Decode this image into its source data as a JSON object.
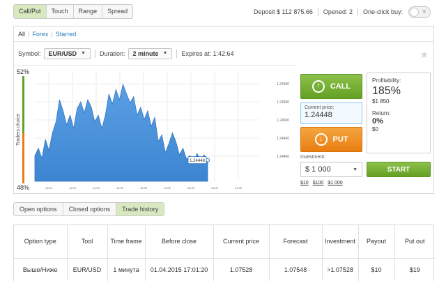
{
  "option_types": [
    "Call/Put",
    "Touch",
    "Range",
    "Spread"
  ],
  "header": {
    "deposit": "Deposit $ 112 875.66",
    "opened": "Opened: 2",
    "one_click": "One-click buy:"
  },
  "filters": {
    "all": "All",
    "forex": "Forex",
    "starred": "Starred"
  },
  "controls": {
    "symbol_label": "Symbol:",
    "symbol_value": "EUR/USD",
    "duration_label": "Duration:",
    "duration_value": "2 minute",
    "expires": "Expires at: 1:42:64"
  },
  "trade": {
    "call_label": "CALL",
    "put_label": "PUT",
    "current_price_label": "Current price:",
    "current_price": "1.24448",
    "investment_label": "Investment:",
    "investment_value": "$ 1 000",
    "presets": [
      "$10",
      "$100",
      "$1 000"
    ],
    "profitability_label": "Profitability:",
    "profitability_pct": "185%",
    "profitability_amount": "$1 850",
    "return_label": "Return:",
    "return_pct": "0%",
    "return_amount": "$0",
    "start_label": "START"
  },
  "chart_data": {
    "type": "area",
    "ylabel": "Traders choice",
    "sentiment_top": "52%",
    "sentiment_bottom": "48%",
    "y_ticks": [
      "1.24600",
      "1.24550",
      "1.24500",
      "1.24450",
      "1.24400"
    ],
    "x_ticks": [
      "10:00",
      "11:00",
      "11:20",
      "12:00",
      "12:30",
      "13:00",
      "13:30",
      "14:00",
      "14:30"
    ],
    "current_label": "1.24448",
    "y_range": [
      1.244,
      1.2465
    ],
    "values": [
      1.24458,
      1.24475,
      1.24452,
      1.24495,
      1.2447,
      1.2451,
      1.24535,
      1.24585,
      1.2456,
      1.24528,
      1.2455,
      1.2452,
      1.24565,
      1.2458,
      1.24555,
      1.24585,
      1.24568,
      1.24535,
      1.2455,
      1.2452,
      1.2455,
      1.24598,
      1.24575,
      1.24608,
      1.24585,
      1.2462,
      1.24598,
      1.24578,
      1.24592,
      1.2455,
      1.24568,
      1.2454,
      1.2456,
      1.24525,
      1.24545,
      1.2449,
      1.24505,
      1.24465,
      1.24485,
      1.2451,
      1.2449,
      1.2446,
      1.24475,
      1.2445,
      1.24458,
      1.24445,
      1.24463,
      1.24448,
      1.2446,
      1.24448
    ]
  },
  "bottom_tabs": [
    "Open options",
    "Closed options",
    "Trade history"
  ],
  "table": {
    "headers": [
      "Option type",
      "Tool",
      "Time frame",
      "Before close",
      "Current price",
      "Forecast",
      "Investment",
      "Payout",
      "Put out"
    ],
    "rows": [
      [
        "Выше/Ниже",
        "EUR/USD",
        "1 минута",
        "01.04.2015 17:01:20",
        "1.07528",
        "1.07548",
        ">1.07528",
        "$10",
        "$19"
      ]
    ]
  },
  "colors": {
    "call": "#64a024",
    "put": "#e87e12",
    "area": "#4a90d9",
    "active_tab": "#d8e9c0"
  }
}
